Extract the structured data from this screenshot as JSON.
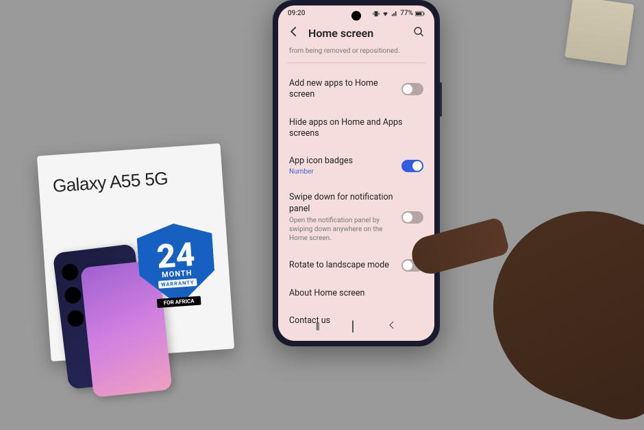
{
  "status": {
    "time": "09:20",
    "battery": "77%"
  },
  "header": {
    "title": "Home screen"
  },
  "partial_desc": "from being removed or repositioned.",
  "rows": {
    "add_apps": {
      "title": "Add new apps to Home screen"
    },
    "hide_apps": {
      "title": "Hide apps on Home and Apps screens"
    },
    "badges": {
      "title": "App icon badges",
      "sub": "Number"
    },
    "swipe": {
      "title": "Swipe down for notification panel",
      "desc": "Open the notification panel by swiping down anywhere on the Home screen."
    },
    "rotate": {
      "title": "Rotate to landscape mode"
    },
    "about": {
      "title": "About Home screen"
    },
    "contact": {
      "title": "Contact us"
    }
  },
  "box": {
    "product": "Galaxy A55 5G",
    "badge_num": "24",
    "badge_month": "MONTH",
    "badge_warranty": "WARRANTY",
    "badge_africa": "FOR AFRICA"
  }
}
